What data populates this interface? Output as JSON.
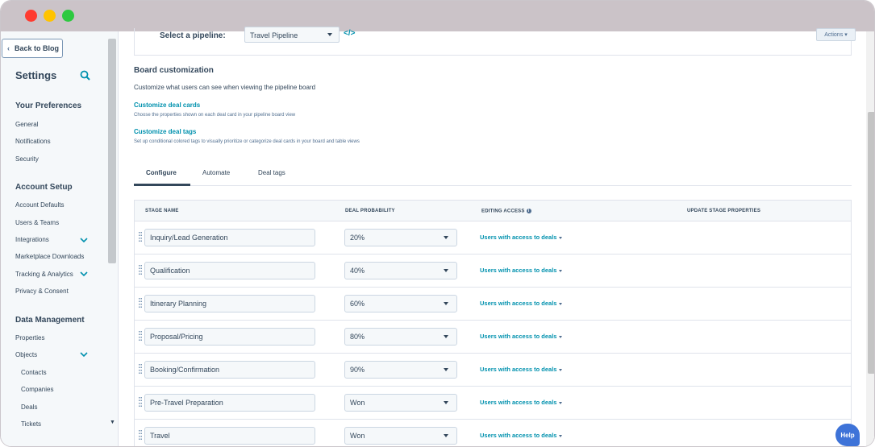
{
  "sidebar": {
    "back_label": "Back to Blog",
    "title": "Settings",
    "sections": [
      {
        "label": "Your Preferences"
      },
      {
        "label": "Account Setup"
      },
      {
        "label": "Data Management"
      }
    ],
    "items": [
      {
        "label": "General"
      },
      {
        "label": "Notifications"
      },
      {
        "label": "Security"
      },
      {
        "label": "Account Defaults"
      },
      {
        "label": "Users & Teams"
      },
      {
        "label": "Integrations"
      },
      {
        "label": "Marketplace Downloads"
      },
      {
        "label": "Tracking & Analytics"
      },
      {
        "label": "Privacy & Consent"
      },
      {
        "label": "Properties"
      },
      {
        "label": "Objects"
      },
      {
        "label": "Contacts"
      },
      {
        "label": "Companies"
      },
      {
        "label": "Deals"
      },
      {
        "label": "Tickets"
      }
    ]
  },
  "pipeline": {
    "label": "Select a pipeline:",
    "selected": "Travel Pipeline",
    "actions_label": "Actions"
  },
  "board": {
    "title": "Board customization",
    "description": "Customize what users can see when viewing the pipeline board",
    "links": [
      {
        "title": "Customize deal cards",
        "desc": "Choose the properties shown on each deal card in your pipeline board view"
      },
      {
        "title": "Customize deal tags",
        "desc": "Set up conditional colored tags to visually prioritize or categorize deal cards in your board and table views"
      }
    ]
  },
  "tabs": [
    {
      "label": "Configure"
    },
    {
      "label": "Automate"
    },
    {
      "label": "Deal tags"
    }
  ],
  "table": {
    "headers": {
      "stage": "STAGE NAME",
      "probability": "DEAL PROBABILITY",
      "access": "EDITING ACCESS",
      "update": "UPDATE STAGE PROPERTIES"
    },
    "rows": [
      {
        "stage": "Inquiry/Lead Generation",
        "prob": "20%",
        "access": "Users with access to deals"
      },
      {
        "stage": "Qualification",
        "prob": "40%",
        "access": "Users with access to deals"
      },
      {
        "stage": "Itinerary Planning",
        "prob": "60%",
        "access": "Users with access to deals"
      },
      {
        "stage": "Proposal/Pricing",
        "prob": "80%",
        "access": "Users with access to deals"
      },
      {
        "stage": "Booking/Confirmation",
        "prob": "90%",
        "access": "Users with access to deals"
      },
      {
        "stage": "Pre-Travel Preparation",
        "prob": "Won",
        "access": "Users with access to deals"
      },
      {
        "stage": "Travel",
        "prob": "Won",
        "access": "Users with access to deals"
      }
    ]
  },
  "help_label": "Help",
  "colors": {
    "accent": "#0091ae",
    "text": "#33475b",
    "help": "#3e73d8"
  }
}
